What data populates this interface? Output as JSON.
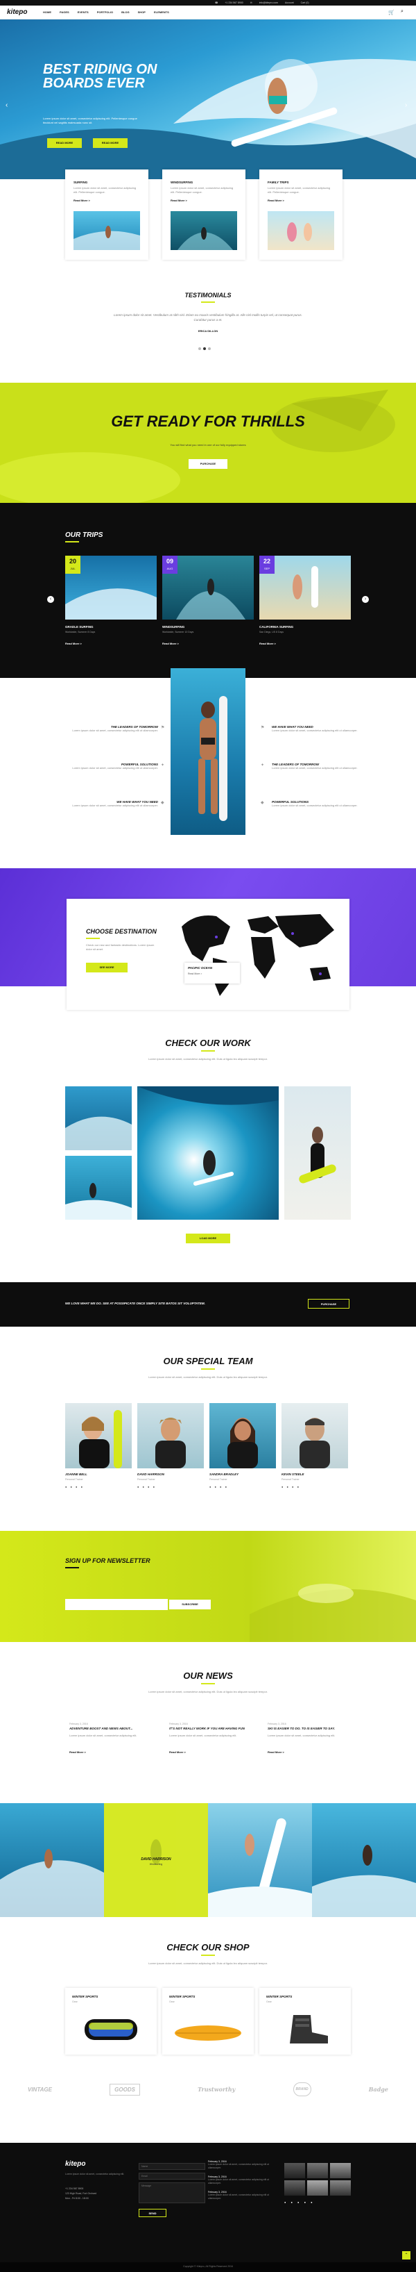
{
  "topbar": {
    "phone": "+1 234 567 8900",
    "email": "info@kitepro.com",
    "account": "Account",
    "cart": "Cart (0)"
  },
  "header": {
    "logo": "kitepo",
    "nav": [
      "HOME",
      "PAGES",
      "EVENTS",
      "PORTFOLIO",
      "BLOG",
      "SHOP",
      "ELEMENTS"
    ]
  },
  "hero": {
    "title_line1": "BEST RIDING ON",
    "title_line2": "BOARDS EVER",
    "text": "Lorem ipsum dolor sit amet, consectetur adipiscing elit. Pellentesque congue tincidunt vel sagittis malesuada nunc sit.",
    "btn1": "READ MORE",
    "btn2": "READ MORE"
  },
  "features": [
    {
      "title": "SURFING",
      "text": "Lorem ipsum dolor sit amet, consectetur adipiscing elit. Pellentesque congue.",
      "link": "Read More >"
    },
    {
      "title": "WINDSURFING",
      "text": "Lorem ipsum dolor sit amet, consectetur adipiscing elit. Pellentesque congue.",
      "link": "Read More >"
    },
    {
      "title": "FAMILY TRIPS",
      "text": "Lorem ipsum dolor sit amet, consectetur adipiscing elit. Pellentesque congue.",
      "link": "Read More >"
    }
  ],
  "testimonials": {
    "title": "TESTIMONIALS",
    "quote": "Lorem ipsum dolor sit amet. Vestibulum at nibh nisl. Etiam eu mauris vestibulum fringilla at. Alle nisl mollis turpis vel, ut consequat purus. Curabitur purus a et.",
    "author": "ERICA DILLON"
  },
  "thrills": {
    "title": "GET READY FOR THRILLS",
    "text": "You will find what you need in one of our fully equipped stores",
    "btn": "PURCHASE"
  },
  "trips": {
    "title": "OUR TRIPS",
    "items": [
      {
        "day": "20",
        "month": "JUL",
        "name": "GRADLE SURFING",
        "meta": "Worldwide, Summer  8 Days",
        "link": "Read More >"
      },
      {
        "day": "09",
        "month": "AUG",
        "name": "WINDSURFING",
        "meta": "Worldwide, Summer  10 Days",
        "link": "Read More >"
      },
      {
        "day": "22",
        "month": "SEP",
        "name": "CALIFORNIA SURFING",
        "meta": "San Diego, US  8 Days",
        "link": "Read More >"
      }
    ]
  },
  "about": {
    "left": [
      {
        "title": "THE LEADERS OF TOMORROW",
        "text": "Lorem ipsum dolor sit amet, consectetur adipiscing elit ut ullamcorper."
      },
      {
        "title": "POWERFUL SOLUTIONS",
        "text": "Lorem ipsum dolor sit amet, consectetur adipiscing elit ut ullamcorper."
      },
      {
        "title": "WE HAVE WHAT YOU NEED",
        "text": "Lorem ipsum dolor sit amet, consectetur adipiscing elit ut ullamcorper."
      }
    ],
    "right": [
      {
        "title": "WE HAVE WHAT YOU NEED",
        "text": "Lorem ipsum dolor sit amet, consectetur adipiscing elit ut ullamcorper."
      },
      {
        "title": "THE LEADERS OF TOMORROW",
        "text": "Lorem ipsum dolor sit amet, consectetur adipiscing elit ut ullamcorper."
      },
      {
        "title": "POWERFUL SOLUTIONS",
        "text": "Lorem ipsum dolor sit amet, consectetur adipiscing elit ut ullamcorper."
      }
    ]
  },
  "destination": {
    "title": "CHOOSE DESTINATION",
    "text": "Check our new and fantastic destinations. Lorem ipsum dolor sit amet.",
    "btn": "SEE MORE",
    "popup_title": "PACIFIC OCEAN",
    "popup_link": "Read More >"
  },
  "work": {
    "title": "CHECK OUR WORK",
    "text": "Lorem ipsum dolor sit amet, consectetur adipiscing elit. Duis ut ligula leo aliquam suscipit tempor.",
    "btn": "LOAD MORE"
  },
  "cta": {
    "text": "WE LOVE WHAT WE DO. SEE AT POSSIPICATE ONCE SIMPLY SITE BATOS SIT VOLUPTATEM.",
    "btn": "PURCHASE"
  },
  "team": {
    "title": "OUR SPECIAL TEAM",
    "text": "Lorem ipsum dolor sit amet, consectetur adipiscing elit. Duis ut ligula leo aliquam suscipit tempor.",
    "members": [
      {
        "name": "JOANNE BELL",
        "role": "Personal Trainer"
      },
      {
        "name": "DAVID HARRISON",
        "role": "Personal Trainer"
      },
      {
        "name": "SANDRA BRADLEY",
        "role": "Personal Trainer"
      },
      {
        "name": "KEVIN STEELE",
        "role": "Personal Trainer"
      }
    ]
  },
  "newsletter": {
    "title": "SIGN UP FOR NEWSLETTER",
    "placeholder": "",
    "btn": "SUBSCRIBE"
  },
  "news": {
    "title": "OUR NEWS",
    "text": "Lorem ipsum dolor sit amet, consectetur adipiscing elit. Duis ut ligula leo aliquam suscipit tempor.",
    "items": [
      {
        "date": "February 3, 2016",
        "title": "ADVENTURE BOOST AND NEWS ABOUT...",
        "text": "Lorem ipsum dolor sit amet, consectetur adipiscing elit.",
        "link": "Read More >"
      },
      {
        "date": "February 3, 2016",
        "title": "IT'S NOT REALLY WORK IF YOU ARE HAVING FUN",
        "text": "Lorem ipsum dolor sit amet, consectetur adipiscing elit.",
        "link": "Read More >"
      },
      {
        "date": "February 3, 2016",
        "title": "SKI IS EASIER TO DO. TO IS EASIER TO SAY.",
        "text": "Lorem ipsum dolor sit amet, consectetur adipiscing elit.",
        "link": "Read More >"
      }
    ]
  },
  "gallery": {
    "overlay_title": "DAVID HARRISON",
    "overlay_sub": "Windsurfing"
  },
  "shop": {
    "title": "CHECK OUR SHOP",
    "text": "Lorem ipsum dolor sit amet, consectetur adipiscing elit. Duis ut ligula leo aliquam suscipit tempor.",
    "items": [
      {
        "cat": "WINTER SPORTS",
        "sub": "Gear"
      },
      {
        "cat": "WINTER SPORTS",
        "sub": "Gear"
      },
      {
        "cat": "WINTER SPORTS",
        "sub": "Gear"
      }
    ]
  },
  "brands": [
    "VINTAGE",
    "GOODS",
    "Trustworthy",
    "BRAND",
    "Badge"
  ],
  "footer": {
    "logo": "kitepo",
    "about": "Lorem ipsum dolor sit amet, consectetur adipiscing elit.",
    "phone": "+1 234 567 8900",
    "address": "123 High Road, Fort Orchard",
    "hours": "Mon - Fri 8:00 - 18:00",
    "form_fields": [
      "Name",
      "Email",
      "Message"
    ],
    "form_btn": "SEND",
    "posts": [
      {
        "date": "February 3, 2016",
        "text": "Lorem ipsum dolor sit amet, consectetur adipiscing elit ut ullamcorper."
      },
      {
        "date": "February 3, 2016",
        "text": "Lorem ipsum dolor sit amet, consectetur adipiscing elit ut ullamcorper."
      },
      {
        "date": "February 3, 2016",
        "text": "Lorem ipsum dolor sit amet, consectetur adipiscing elit ut ullamcorper."
      }
    ],
    "copyright": "Copyright © Kitepro, All Rights Reserved 2016"
  },
  "colors": {
    "accent": "#d4e81a",
    "dark": "#0d0d0d",
    "purple": "#6a3de0"
  }
}
